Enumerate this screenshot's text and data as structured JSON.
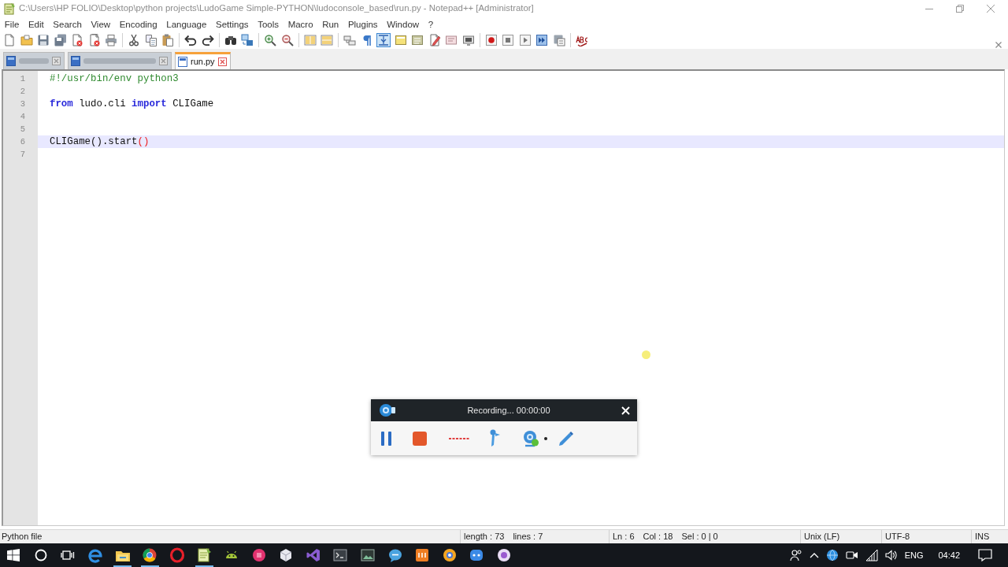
{
  "window": {
    "title": "C:\\Users\\HP FOLIO\\Desktop\\python projects\\LudoGame Simple-PYTHON\\ludoconsole_based\\run.py - Notepad++ [Administrator]"
  },
  "menu": [
    "File",
    "Edit",
    "Search",
    "View",
    "Encoding",
    "Language",
    "Settings",
    "Tools",
    "Macro",
    "Run",
    "Plugins",
    "Window",
    "?"
  ],
  "toolbar": [
    {
      "pressed": false
    },
    {
      "pressed": false
    },
    {
      "pressed": false
    },
    {
      "pressed": false
    },
    {
      "pressed": false
    },
    {
      "pressed": false
    },
    {
      "pressed": false
    },
    {
      "pressed": false
    },
    {
      "pressed": false
    },
    {
      "pressed": false
    },
    {
      "pressed": false
    },
    {
      "pressed": false
    },
    {
      "pressed": false
    },
    {
      "pressed": false
    },
    {
      "pressed": false
    },
    {
      "pressed": false
    },
    {
      "pressed": false
    },
    {
      "pressed": false
    },
    {
      "pressed": false
    },
    {
      "pressed": false
    },
    {
      "pressed": true
    },
    {
      "pressed": false
    },
    {
      "pressed": false
    },
    {
      "pressed": false
    },
    {
      "pressed": false
    },
    {
      "pressed": false
    },
    {
      "pressed": false
    },
    {
      "pressed": false
    },
    {
      "pressed": false
    },
    {
      "pressed": false
    },
    {
      "pressed": false
    },
    {
      "pressed": false
    }
  ],
  "tabs": [
    {
      "selected": false
    },
    {
      "selected": false
    },
    {
      "label": "run.py",
      "selected": true
    }
  ],
  "editor": {
    "lines": [
      {
        "number": "1",
        "current": false,
        "tokens": [
          {
            "kind": "comment",
            "text": "#!/usr/bin/env python3"
          }
        ]
      },
      {
        "number": "2",
        "current": false
      },
      {
        "number": "3",
        "current": false,
        "tokens": [
          {
            "kind": "keyword",
            "text": "from"
          },
          {
            "kind": "plain",
            "text": " ludo.cli "
          },
          {
            "kind": "keyword",
            "text": "import"
          },
          {
            "kind": "plain",
            "text": " CLIGame"
          }
        ]
      },
      {
        "number": "4",
        "current": false
      },
      {
        "number": "5",
        "current": false
      },
      {
        "number": "6",
        "current": true,
        "tokens": [
          {
            "kind": "plain",
            "text": "CLIGame().start"
          },
          {
            "kind": "brace",
            "text": "()"
          }
        ]
      },
      {
        "number": "7",
        "current": false
      }
    ]
  },
  "recorder": {
    "title": "Recording... 00:00:00"
  },
  "status_bar": {
    "file_type": "Python file",
    "length": "length : 73",
    "lines": "lines : 7",
    "line": "Ln : 6",
    "column": "Col : 18",
    "selection": "Sel : 0 | 0",
    "line_ending": "Unix (LF)",
    "encoding": "UTF-8",
    "mode": "INS"
  },
  "taskbar": {
    "apps": [
      {
        "running": false
      },
      {
        "running": true
      },
      {
        "running": true
      },
      {
        "running": false
      },
      {
        "running": true
      },
      {
        "running": false
      },
      {
        "running": false
      },
      {
        "running": false
      },
      {
        "running": false
      },
      {
        "running": false
      },
      {
        "running": false
      },
      {
        "running": false
      },
      {
        "running": false
      },
      {
        "running": false
      },
      {
        "running": false
      },
      {
        "running": false
      }
    ],
    "language": "ENG",
    "clock": "04:42"
  }
}
